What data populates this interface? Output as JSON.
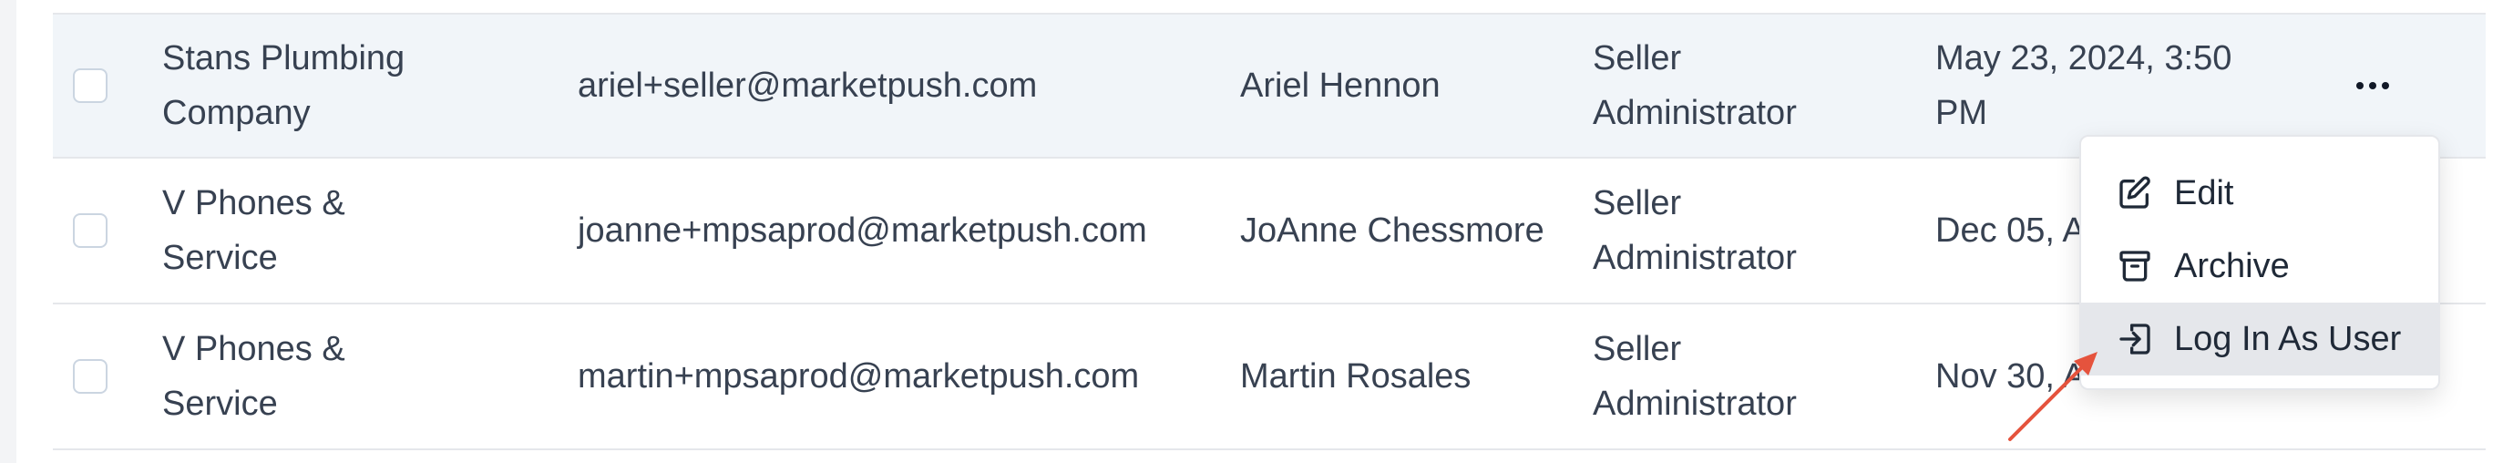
{
  "rows": [
    {
      "company": "Stans Plumbing Company",
      "email": "ariel+seller@marketpush.com",
      "name": "Ariel Hennon",
      "role": "Seller Administrator",
      "date": "May 23, 2024, 3:50 PM"
    },
    {
      "company": "V Phones & Service",
      "email": "joanne+mpsaprod@marketpush.com",
      "name": "JoAnne Chessmore",
      "role": "Seller Administrator",
      "date": "Dec 05, AM"
    },
    {
      "company": "V Phones & Service",
      "email": "martin+mpsaprod@marketpush.com",
      "name": "Martin Rosales",
      "role": "Seller Administrator",
      "date": "Nov 30, AM"
    }
  ],
  "menu": {
    "items": [
      {
        "label": "Edit",
        "icon": "edit-icon"
      },
      {
        "label": "Archive",
        "icon": "archive-icon"
      },
      {
        "label": "Log In As User",
        "icon": "login-icon"
      }
    ]
  },
  "colors": {
    "row_highlight": "#f1f5f9",
    "active_menu_item": "#e5e7eb",
    "annotation_arrow": "#e5533d"
  }
}
